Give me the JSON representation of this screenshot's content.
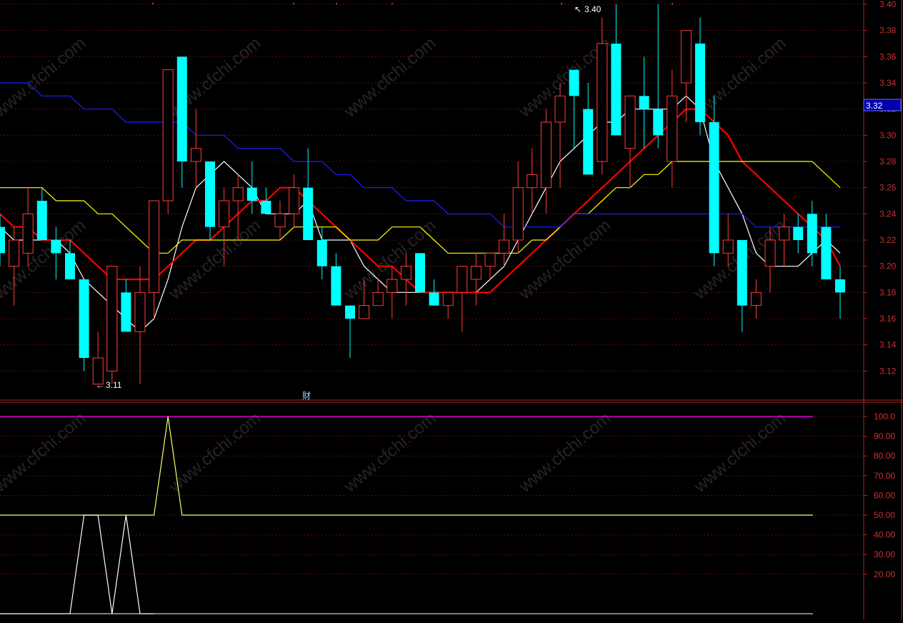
{
  "app": {
    "watermark": "www.cfchi.com",
    "finance_marker": "财",
    "current_price_label": "3.32",
    "high_label": "3.40",
    "low_label": "3.11"
  },
  "colors": {
    "up": "#ff3c3c",
    "down": "#00ffff",
    "ma_white": "#ffffff",
    "ma_yellow": "#ffff00",
    "ma_red": "#ff0000",
    "ma_blue": "#1e1eff",
    "indicator_line": "#ffff66",
    "indicator_top": "#ff00ff",
    "grid": "#5a0f0f",
    "axis_text": "#c83232",
    "price_box": "#0000aa"
  },
  "chart_data": [
    {
      "type": "candlestick",
      "ylim": [
        3.1,
        3.4
      ],
      "yticks": [
        "3.40",
        "3.38",
        "3.36",
        "3.34",
        "3.32",
        "3.30",
        "3.28",
        "3.26",
        "3.24",
        "3.22",
        "3.20",
        "3.18",
        "3.16",
        "3.14",
        "3.12"
      ],
      "candles": [
        {
          "o": 3.23,
          "h": 3.24,
          "l": 3.2,
          "c": 3.21
        },
        {
          "o": 3.2,
          "h": 3.23,
          "l": 3.17,
          "c": 3.22
        },
        {
          "o": 3.21,
          "h": 3.26,
          "l": 3.2,
          "c": 3.24
        },
        {
          "o": 3.25,
          "h": 3.26,
          "l": 3.22,
          "c": 3.22
        },
        {
          "o": 3.22,
          "h": 3.23,
          "l": 3.19,
          "c": 3.21
        },
        {
          "o": 3.21,
          "h": 3.22,
          "l": 3.19,
          "c": 3.19
        },
        {
          "o": 3.19,
          "h": 3.19,
          "l": 3.12,
          "c": 3.13
        },
        {
          "o": 3.11,
          "h": 3.15,
          "l": 3.11,
          "c": 3.13
        },
        {
          "o": 3.12,
          "h": 3.2,
          "l": 3.11,
          "c": 3.2
        },
        {
          "o": 3.18,
          "h": 3.19,
          "l": 3.15,
          "c": 3.15
        },
        {
          "o": 3.15,
          "h": 3.2,
          "l": 3.11,
          "c": 3.18
        },
        {
          "o": 3.18,
          "h": 3.25,
          "l": 3.16,
          "c": 3.25
        },
        {
          "o": 3.25,
          "h": 3.35,
          "l": 3.24,
          "c": 3.35
        },
        {
          "o": 3.36,
          "h": 3.36,
          "l": 3.26,
          "c": 3.28
        },
        {
          "o": 3.28,
          "h": 3.32,
          "l": 3.26,
          "c": 3.29
        },
        {
          "o": 3.28,
          "h": 3.28,
          "l": 3.22,
          "c": 3.23
        },
        {
          "o": 3.23,
          "h": 3.26,
          "l": 3.2,
          "c": 3.25
        },
        {
          "o": 3.25,
          "h": 3.27,
          "l": 3.22,
          "c": 3.26
        },
        {
          "o": 3.26,
          "h": 3.28,
          "l": 3.24,
          "c": 3.25
        },
        {
          "o": 3.25,
          "h": 3.26,
          "l": 3.24,
          "c": 3.24
        },
        {
          "o": 3.23,
          "h": 3.25,
          "l": 3.22,
          "c": 3.24
        },
        {
          "o": 3.24,
          "h": 3.27,
          "l": 3.23,
          "c": 3.26
        },
        {
          "o": 3.26,
          "h": 3.29,
          "l": 3.22,
          "c": 3.22
        },
        {
          "o": 3.22,
          "h": 3.23,
          "l": 3.19,
          "c": 3.2
        },
        {
          "o": 3.2,
          "h": 3.21,
          "l": 3.17,
          "c": 3.17
        },
        {
          "o": 3.17,
          "h": 3.17,
          "l": 3.13,
          "c": 3.16
        },
        {
          "o": 3.16,
          "h": 3.19,
          "l": 3.16,
          "c": 3.17
        },
        {
          "o": 3.17,
          "h": 3.19,
          "l": 3.17,
          "c": 3.18
        },
        {
          "o": 3.18,
          "h": 3.2,
          "l": 3.16,
          "c": 3.19
        },
        {
          "o": 3.19,
          "h": 3.21,
          "l": 3.17,
          "c": 3.2
        },
        {
          "o": 3.21,
          "h": 3.21,
          "l": 3.18,
          "c": 3.18
        },
        {
          "o": 3.18,
          "h": 3.19,
          "l": 3.17,
          "c": 3.17
        },
        {
          "o": 3.17,
          "h": 3.18,
          "l": 3.16,
          "c": 3.18
        },
        {
          "o": 3.18,
          "h": 3.2,
          "l": 3.15,
          "c": 3.2
        },
        {
          "o": 3.19,
          "h": 3.21,
          "l": 3.17,
          "c": 3.2
        },
        {
          "o": 3.2,
          "h": 3.21,
          "l": 3.19,
          "c": 3.21
        },
        {
          "o": 3.21,
          "h": 3.24,
          "l": 3.2,
          "c": 3.22
        },
        {
          "o": 3.22,
          "h": 3.28,
          "l": 3.21,
          "c": 3.26
        },
        {
          "o": 3.26,
          "h": 3.29,
          "l": 3.24,
          "c": 3.27
        },
        {
          "o": 3.26,
          "h": 3.32,
          "l": 3.24,
          "c": 3.31
        },
        {
          "o": 3.31,
          "h": 3.34,
          "l": 3.26,
          "c": 3.33
        },
        {
          "o": 3.35,
          "h": 3.35,
          "l": 3.29,
          "c": 3.33
        },
        {
          "o": 3.32,
          "h": 3.34,
          "l": 3.27,
          "c": 3.27
        },
        {
          "o": 3.28,
          "h": 3.39,
          "l": 3.27,
          "c": 3.37
        },
        {
          "o": 3.37,
          "h": 3.4,
          "l": 3.3,
          "c": 3.3
        },
        {
          "o": 3.29,
          "h": 3.33,
          "l": 3.26,
          "c": 3.33
        },
        {
          "o": 3.33,
          "h": 3.36,
          "l": 3.29,
          "c": 3.32
        },
        {
          "o": 3.32,
          "h": 3.4,
          "l": 3.29,
          "c": 3.3
        },
        {
          "o": 3.28,
          "h": 3.35,
          "l": 3.26,
          "c": 3.33
        },
        {
          "o": 3.34,
          "h": 3.38,
          "l": 3.31,
          "c": 3.38
        },
        {
          "o": 3.37,
          "h": 3.39,
          "l": 3.3,
          "c": 3.31
        },
        {
          "o": 3.31,
          "h": 3.33,
          "l": 3.2,
          "c": 3.21
        },
        {
          "o": 3.21,
          "h": 3.24,
          "l": 3.2,
          "c": 3.22
        },
        {
          "o": 3.22,
          "h": 3.22,
          "l": 3.15,
          "c": 3.17
        },
        {
          "o": 3.17,
          "h": 3.19,
          "l": 3.16,
          "c": 3.18
        },
        {
          "o": 3.2,
          "h": 3.23,
          "l": 3.18,
          "c": 3.22
        },
        {
          "o": 3.22,
          "h": 3.24,
          "l": 3.2,
          "c": 3.23
        },
        {
          "o": 3.23,
          "h": 3.24,
          "l": 3.21,
          "c": 3.22
        },
        {
          "o": 3.24,
          "h": 3.25,
          "l": 3.2,
          "c": 3.21
        },
        {
          "o": 3.23,
          "h": 3.24,
          "l": 3.19,
          "c": 3.19
        },
        {
          "o": 3.19,
          "h": 3.2,
          "l": 3.16,
          "c": 3.18
        }
      ],
      "ma": [
        {
          "name": "MA5",
          "color": "#ffffff",
          "values": [
            3.23,
            3.22,
            3.22,
            3.22,
            3.22,
            3.21,
            3.19,
            3.18,
            3.17,
            3.16,
            3.15,
            3.16,
            3.19,
            3.23,
            3.26,
            3.27,
            3.28,
            3.27,
            3.26,
            3.24,
            3.24,
            3.24,
            3.25,
            3.22,
            3.22,
            3.22,
            3.2,
            3.19,
            3.18,
            3.18,
            3.18,
            3.18,
            3.18,
            3.18,
            3.18,
            3.19,
            3.2,
            3.22,
            3.24,
            3.26,
            3.28,
            3.29,
            3.3,
            3.31,
            3.31,
            3.32,
            3.32,
            3.32,
            3.32,
            3.33,
            3.32,
            3.28,
            3.26,
            3.24,
            3.21,
            3.2,
            3.2,
            3.2,
            3.21,
            3.22,
            3.21
          ]
        },
        {
          "name": "MA10",
          "color": "#ff0000",
          "values": [
            3.24,
            3.23,
            3.23,
            3.22,
            3.22,
            3.22,
            3.21,
            3.2,
            3.19,
            3.19,
            3.19,
            3.19,
            3.2,
            3.21,
            3.22,
            3.22,
            3.23,
            3.24,
            3.25,
            3.25,
            3.26,
            3.26,
            3.25,
            3.24,
            3.23,
            3.22,
            3.21,
            3.2,
            3.2,
            3.19,
            3.18,
            3.18,
            3.18,
            3.18,
            3.18,
            3.18,
            3.19,
            3.2,
            3.21,
            3.22,
            3.23,
            3.24,
            3.25,
            3.26,
            3.27,
            3.28,
            3.29,
            3.3,
            3.31,
            3.32,
            3.32,
            3.31,
            3.3,
            3.28,
            3.27,
            3.26,
            3.25,
            3.24,
            3.23,
            3.22,
            3.2
          ]
        },
        {
          "name": "MA30",
          "color": "#ffff00",
          "values": [
            3.26,
            3.26,
            3.26,
            3.26,
            3.25,
            3.25,
            3.25,
            3.24,
            3.24,
            3.23,
            3.22,
            3.21,
            3.21,
            3.22,
            3.22,
            3.22,
            3.22,
            3.22,
            3.22,
            3.22,
            3.22,
            3.23,
            3.23,
            3.23,
            3.23,
            3.22,
            3.22,
            3.22,
            3.23,
            3.23,
            3.23,
            3.22,
            3.21,
            3.21,
            3.21,
            3.21,
            3.21,
            3.21,
            3.22,
            3.22,
            3.23,
            3.24,
            3.24,
            3.25,
            3.26,
            3.26,
            3.27,
            3.27,
            3.28,
            3.28,
            3.28,
            3.28,
            3.28,
            3.28,
            3.28,
            3.28,
            3.28,
            3.28,
            3.28,
            3.27,
            3.26
          ]
        },
        {
          "name": "MA60",
          "color": "#1e1eff",
          "values": [
            3.34,
            3.34,
            3.34,
            3.33,
            3.33,
            3.33,
            3.32,
            3.32,
            3.32,
            3.31,
            3.31,
            3.31,
            3.31,
            3.31,
            3.3,
            3.3,
            3.3,
            3.29,
            3.29,
            3.29,
            3.29,
            3.28,
            3.28,
            3.28,
            3.27,
            3.27,
            3.26,
            3.26,
            3.26,
            3.25,
            3.25,
            3.25,
            3.24,
            3.24,
            3.24,
            3.24,
            3.23,
            3.23,
            3.23,
            3.23,
            3.23,
            3.24,
            3.24,
            3.24,
            3.24,
            3.24,
            3.24,
            3.24,
            3.24,
            3.24,
            3.24,
            3.24,
            3.24,
            3.24,
            3.23,
            3.23,
            3.23,
            3.23,
            3.23,
            3.23,
            3.23
          ]
        }
      ]
    },
    {
      "type": "line",
      "ylim": [
        0,
        100
      ],
      "yticks": [
        "100.0",
        "90.00",
        "80.00",
        "70.00",
        "60.00",
        "50.00",
        "40.00",
        "30.00",
        "20.00"
      ],
      "reference_line": 100,
      "series": [
        {
          "color": "#ffff66",
          "points": [
            [
              0,
              50
            ],
            [
              11,
              50
            ],
            [
              12,
              100
            ],
            [
              13,
              50
            ],
            [
              57,
              50
            ]
          ]
        },
        {
          "color": "#ffffff",
          "points": [
            [
              0,
              0
            ],
            [
              5,
              0
            ],
            [
              6,
              50
            ],
            [
              7,
              50
            ],
            [
              8,
              0
            ],
            [
              9,
              50
            ],
            [
              10,
              0
            ],
            [
              11,
              0
            ]
          ]
        }
      ]
    }
  ]
}
